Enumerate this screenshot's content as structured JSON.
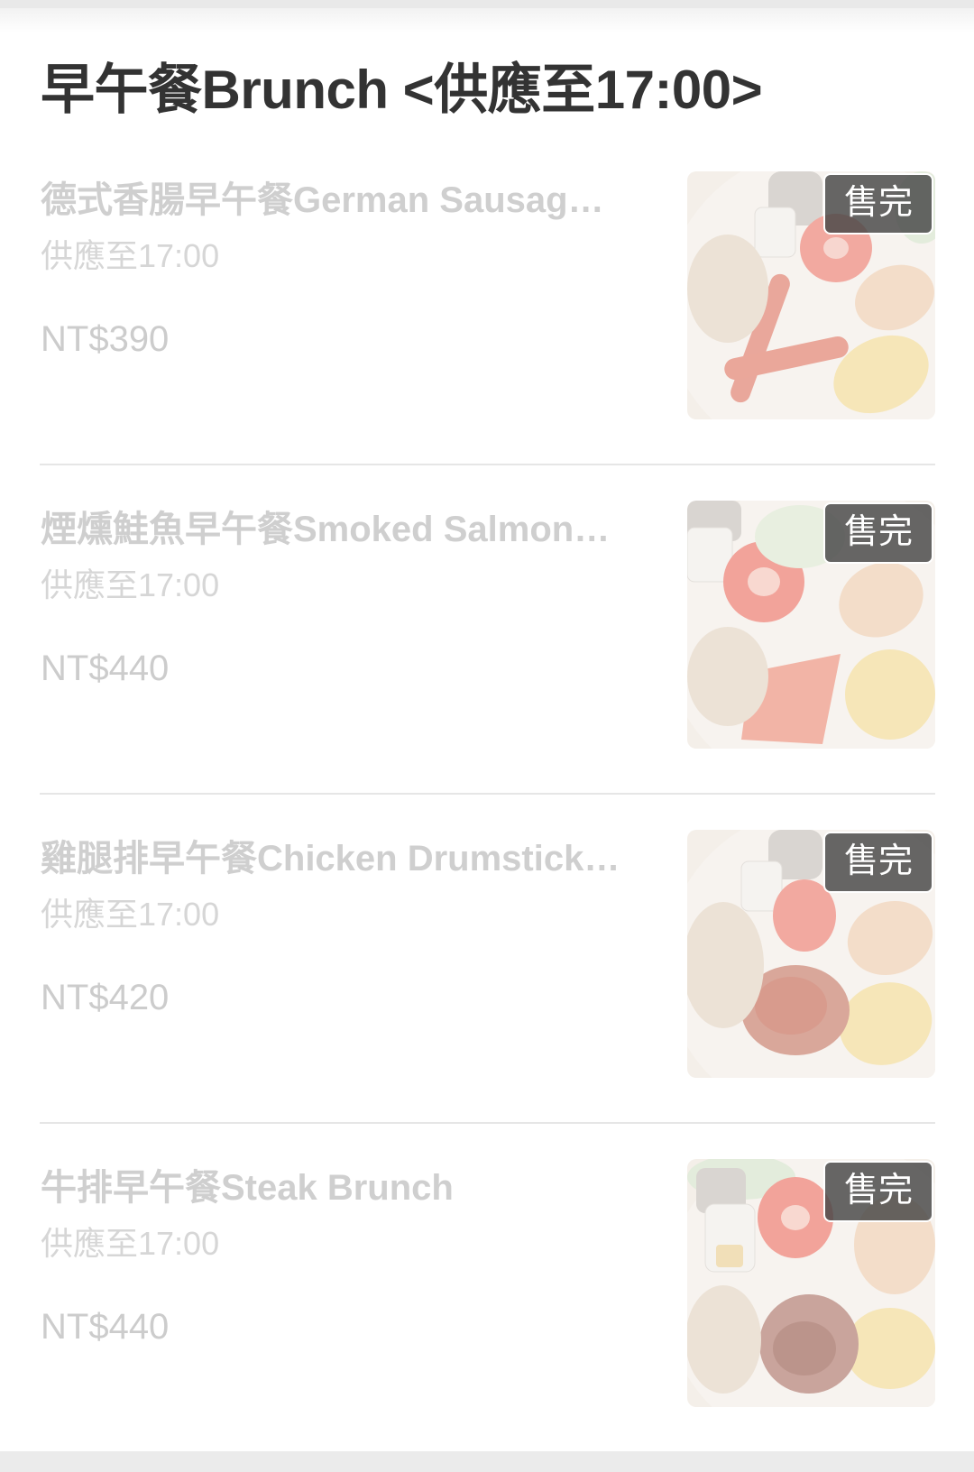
{
  "section": {
    "title": "早午餐Brunch <供應至17:00>"
  },
  "items": [
    {
      "name": "德式香腸早午餐German Sausag…",
      "note": "供應至17:00",
      "price": "NT$390",
      "badge": "售完"
    },
    {
      "name": "煙燻鮭魚早午餐Smoked Salmon…",
      "note": "供應至17:00",
      "price": "NT$440",
      "badge": "售完"
    },
    {
      "name": "雞腿排早午餐Chicken Drumstick…",
      "note": "供應至17:00",
      "price": "NT$420",
      "badge": "售完"
    },
    {
      "name": "牛排早午餐Steak Brunch",
      "note": "供應至17:00",
      "price": "NT$440",
      "badge": "售完"
    }
  ],
  "colors": {
    "title": "#333333",
    "disabled_text": "#cccccc",
    "badge_bg": "#464646"
  }
}
